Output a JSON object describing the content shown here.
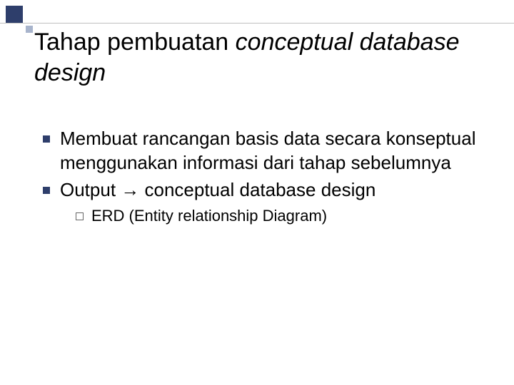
{
  "title": {
    "part1": "Tahap pembuatan ",
    "part2_italic": "conceptual database design"
  },
  "bullets": [
    {
      "text": "Membuat rancangan basis data secara konseptual menggunakan informasi dari tahap sebelumnya"
    },
    {
      "text": "Output → conceptual database design",
      "sub": [
        {
          "text": "ERD (Entity relationship Diagram)"
        }
      ]
    }
  ]
}
